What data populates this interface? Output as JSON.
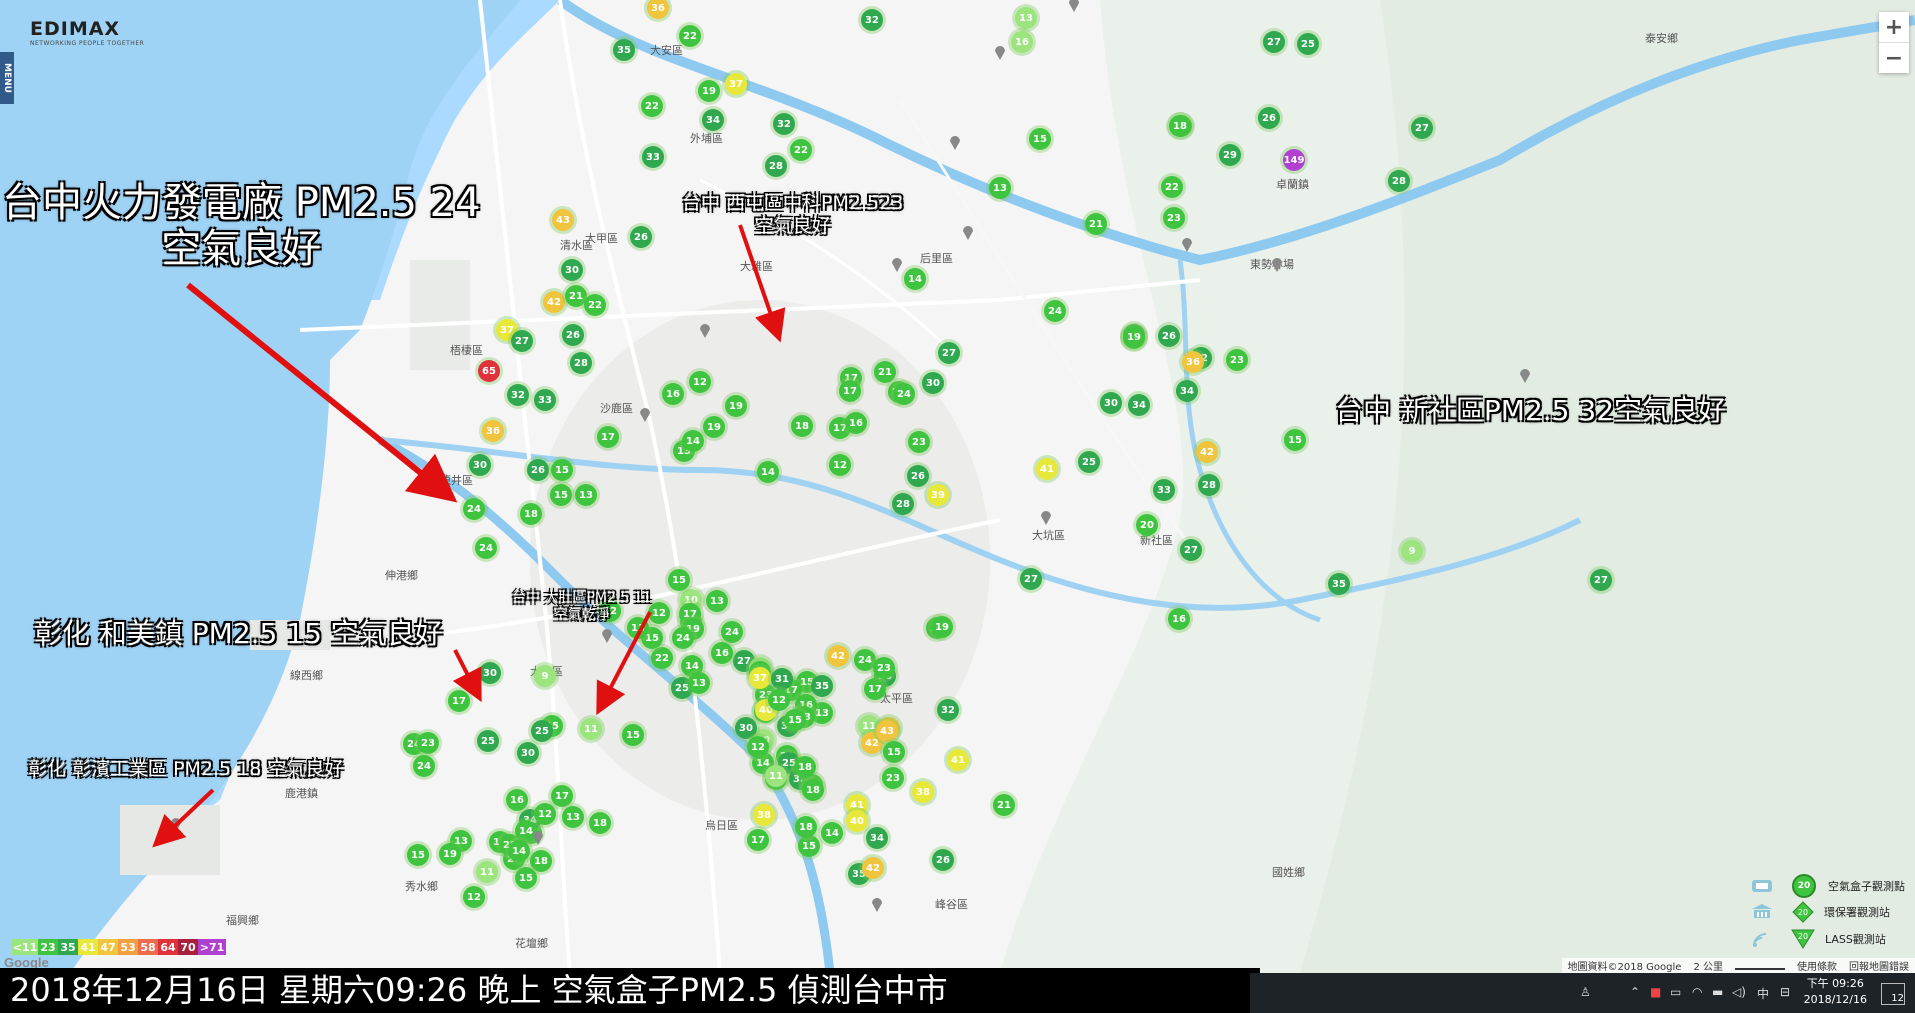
{
  "brand": {
    "name": "EDIMAX",
    "tagline": "NETWORKING PEOPLE TOGETHER"
  },
  "menu_label": "MENU",
  "zoom": {
    "in": "+",
    "out": "−"
  },
  "annotations": [
    {
      "id": "taichung-power",
      "lines": [
        "台中火力發電廠 PM2.5 24",
        "空氣良好"
      ]
    },
    {
      "id": "xitun",
      "lines": [
        "台中 西屯區中科PM2.523",
        "空氣良好"
      ]
    },
    {
      "id": "xinshe",
      "lines": [
        "台中 新社區PM2.5  32空氣良好"
      ]
    },
    {
      "id": "dadu",
      "lines": [
        "台中 大肚區PM2.5 11",
        "空氣乾淨"
      ]
    },
    {
      "id": "hemei",
      "lines": [
        "彰化 和美鎮 PM2.5 15 空氣良好"
      ]
    },
    {
      "id": "changbin",
      "lines": [
        "彰化 彰濱工業區 PM2.5  18 空氣良好"
      ]
    }
  ],
  "place_names": [
    "大安區",
    "大甲區",
    "大雅區",
    "沙鹿區",
    "梧棲區",
    "龍井區",
    "伸港鄉",
    "線西鄉",
    "大肚區",
    "鹿港鎮",
    "秀水鄉",
    "花壇鄉",
    "福興鄉",
    "峰谷區",
    "國姓鄉",
    "泰安鄉",
    "卓蘭鎮",
    "大坑區",
    "烏日區",
    "新社區",
    "東勢林場",
    "太平區",
    "后里區",
    "外埔區",
    "清水區"
  ],
  "legend": [
    {
      "label": "空氣盒子觀測點",
      "icon": "airbox-station-icon"
    },
    {
      "label": "環保署觀測站",
      "icon": "epa-station-icon"
    },
    {
      "label": "LASS觀測站",
      "icon": "lass-station-icon"
    }
  ],
  "legend_sample_value": "20",
  "pm_scale": [
    {
      "label": "<11",
      "color": "#9be47e"
    },
    {
      "label": "23",
      "color": "#3fc43f"
    },
    {
      "label": "35",
      "color": "#2fa84f"
    },
    {
      "label": "41",
      "color": "#e8e83a"
    },
    {
      "label": "47",
      "color": "#f0c43c"
    },
    {
      "label": "53",
      "color": "#f0a040"
    },
    {
      "label": "58",
      "color": "#ec6c4c"
    },
    {
      "label": "64",
      "color": "#e0323a"
    },
    {
      "label": "70",
      "color": "#a8203c"
    },
    {
      "label": ">71",
      "color": "#b040d0"
    }
  ],
  "attribution": {
    "data": "地圖資料©2018 Google",
    "scale": "2 公里",
    "terms": "使用條款",
    "report": "回報地圖錯誤"
  },
  "google_logo": "Google",
  "caption": "2018年12月16日 星期六09:26 晚上 空氣盒子PM2.5 偵測台中市",
  "clock": {
    "time": "下午 09:26",
    "date": "2018/12/16"
  },
  "notifications": "12",
  "tray_ime": "中",
  "markers": [
    [
      "36",
      "#f0c43c"
    ],
    [
      "32",
      "#2fa84f"
    ],
    [
      "13",
      "#9be47e"
    ],
    [
      "16",
      "#9be47e"
    ],
    [
      "22",
      "#3fc43f"
    ],
    [
      "27",
      "#2fa84f"
    ],
    [
      "25",
      "#2fa84f"
    ],
    [
      "35",
      "#2fa84f"
    ],
    [
      "19",
      "#3fc43f"
    ],
    [
      "37",
      "#e8e83a"
    ],
    [
      "34",
      "#2fa84f"
    ],
    [
      "22",
      "#3fc43f"
    ],
    [
      "32",
      "#2fa84f"
    ],
    [
      "33",
      "#2fa84f"
    ],
    [
      "28",
      "#2fa84f"
    ],
    [
      "22",
      "#3fc43f"
    ],
    [
      "18",
      "#3fc43f"
    ],
    [
      "15",
      "#3fc43f"
    ],
    [
      "18",
      "#3fc43f"
    ],
    [
      "26",
      "#2fa84f"
    ],
    [
      "29",
      "#2fa84f"
    ],
    [
      "149",
      "#b040d0"
    ],
    [
      "13",
      "#3fc43f"
    ],
    [
      "22",
      "#3fc43f"
    ],
    [
      "21",
      "#3fc43f"
    ],
    [
      "23",
      "#3fc43f"
    ],
    [
      "28",
      "#2fa84f"
    ],
    [
      "27",
      "#2fa84f"
    ],
    [
      "43",
      "#f0c43c"
    ],
    [
      "26",
      "#2fa84f"
    ],
    [
      "30",
      "#2fa84f"
    ],
    [
      "14",
      "#3fc43f"
    ],
    [
      "42",
      "#f0c43c"
    ],
    [
      "21",
      "#3fc43f"
    ],
    [
      "22",
      "#3fc43f"
    ],
    [
      "37",
      "#e8e83a"
    ],
    [
      "27",
      "#2fa84f"
    ],
    [
      "26",
      "#2fa84f"
    ],
    [
      "28",
      "#2fa84f"
    ],
    [
      "65",
      "#e0323a"
    ],
    [
      "32",
      "#2fa84f"
    ],
    [
      "33",
      "#2fa84f"
    ],
    [
      "16",
      "#3fc43f"
    ],
    [
      "19",
      "#3fc43f"
    ],
    [
      "29",
      "#2fa84f"
    ],
    [
      "36",
      "#f0c43c"
    ],
    [
      "30",
      "#2fa84f"
    ],
    [
      "26",
      "#2fa84f"
    ],
    [
      "15",
      "#3fc43f"
    ],
    [
      "24",
      "#3fc43f"
    ],
    [
      "24",
      "#3fc43f"
    ],
    [
      "18",
      "#3fc43f"
    ],
    [
      "15",
      "#3fc43f"
    ],
    [
      "13",
      "#3fc43f"
    ],
    [
      "17",
      "#3fc43f"
    ],
    [
      "19",
      "#3fc43f"
    ],
    [
      "17",
      "#3fc43f"
    ],
    [
      "16",
      "#3fc43f"
    ],
    [
      "18",
      "#3fc43f"
    ],
    [
      "14",
      "#3fc43f"
    ],
    [
      "12",
      "#3fc43f"
    ],
    [
      "13",
      "#3fc43f"
    ],
    [
      "14",
      "#3fc43f"
    ],
    [
      "17",
      "#3fc43f"
    ],
    [
      "21",
      "#3fc43f"
    ],
    [
      "27",
      "#2fa84f"
    ],
    [
      "30",
      "#2fa84f"
    ],
    [
      "21",
      "#3fc43f"
    ],
    [
      "24",
      "#3fc43f"
    ],
    [
      "23",
      "#3fc43f"
    ],
    [
      "26",
      "#2fa84f"
    ],
    [
      "12",
      "#3fc43f"
    ],
    [
      "17",
      "#3fc43f"
    ],
    [
      "39",
      "#e8e83a"
    ],
    [
      "28",
      "#2fa84f"
    ],
    [
      "19",
      "#3fc43f"
    ],
    [
      "30",
      "#2fa84f"
    ],
    [
      "34",
      "#2fa84f"
    ],
    [
      "41",
      "#e8e83a"
    ],
    [
      "25",
      "#2fa84f"
    ],
    [
      "33",
      "#2fa84f"
    ],
    [
      "42",
      "#f0c43c"
    ],
    [
      "28",
      "#2fa84f"
    ],
    [
      "20",
      "#3fc43f"
    ],
    [
      "27",
      "#2fa84f"
    ],
    [
      "34",
      "#2fa84f"
    ],
    [
      "32",
      "#2fa84f"
    ],
    [
      "24",
      "#3fc43f"
    ],
    [
      "19",
      "#3fc43f"
    ],
    [
      "26",
      "#2fa84f"
    ],
    [
      "23",
      "#3fc43f"
    ],
    [
      "15",
      "#3fc43f"
    ],
    [
      "9",
      "#9be47e"
    ],
    [
      "27",
      "#2fa84f"
    ],
    [
      "35",
      "#2fa84f"
    ],
    [
      "16",
      "#3fc43f"
    ],
    [
      "36",
      "#f0c43c"
    ],
    [
      "27",
      "#2fa84f"
    ],
    [
      "10",
      "#9be47e"
    ],
    [
      "15",
      "#3fc43f"
    ],
    [
      "14",
      "#3fc43f"
    ],
    [
      "17",
      "#3fc43f"
    ],
    [
      "22",
      "#3fc43f"
    ],
    [
      "12",
      "#3fc43f"
    ],
    [
      "27",
      "#2fa84f"
    ],
    [
      "15",
      "#3fc43f"
    ],
    [
      "13",
      "#3fc43f"
    ],
    [
      "12",
      "#3fc43f"
    ],
    [
      "19",
      "#3fc43f"
    ],
    [
      "24",
      "#3fc43f"
    ],
    [
      "13",
      "#3fc43f"
    ],
    [
      "14",
      "#3fc43f"
    ],
    [
      "24",
      "#3fc43f"
    ],
    [
      "25",
      "#2fa84f"
    ],
    [
      "16",
      "#3fc43f"
    ],
    [
      "23",
      "#3fc43f"
    ],
    [
      "13",
      "#3fc43f"
    ],
    [
      "9",
      "#9be47e"
    ],
    [
      "11",
      "#9be47e"
    ],
    [
      "15",
      "#3fc43f"
    ],
    [
      "14",
      "#3fc43f"
    ],
    [
      "10",
      "#9be47e"
    ],
    [
      "42",
      "#f0c43c"
    ],
    [
      "24",
      "#3fc43f"
    ],
    [
      "28",
      "#2fa84f"
    ],
    [
      "17",
      "#3fc43f"
    ],
    [
      "23",
      "#3fc43f"
    ],
    [
      "11",
      "#9be47e"
    ],
    [
      "15",
      "#3fc43f"
    ],
    [
      "13",
      "#3fc43f"
    ],
    [
      "17",
      "#3fc43f"
    ],
    [
      "14",
      "#3fc43f"
    ],
    [
      "10",
      "#9be47e"
    ],
    [
      "21",
      "#3fc43f"
    ],
    [
      "23",
      "#3fc43f"
    ],
    [
      "22",
      "#3fc43f"
    ],
    [
      "25",
      "#2fa84f"
    ],
    [
      "35",
      "#2fa84f"
    ],
    [
      "36",
      "#f0c43c"
    ],
    [
      "32",
      "#2fa84f"
    ],
    [
      "41",
      "#e8e83a"
    ],
    [
      "38",
      "#e8e83a"
    ],
    [
      "42",
      "#f0c43c"
    ],
    [
      "43",
      "#f0c43c"
    ],
    [
      "17",
      "#3fc43f"
    ],
    [
      "19",
      "#3fc43f"
    ],
    [
      "15",
      "#3fc43f"
    ],
    [
      "23",
      "#3fc43f"
    ],
    [
      "41",
      "#e8e83a"
    ],
    [
      "34",
      "#2fa84f"
    ],
    [
      "40",
      "#e8e83a"
    ],
    [
      "35",
      "#2fa84f"
    ],
    [
      "42",
      "#f0c43c"
    ],
    [
      "38",
      "#e8e83a"
    ],
    [
      "32",
      "#2fa84f"
    ],
    [
      "31",
      "#2fa84f"
    ],
    [
      "37",
      "#e8e83a"
    ],
    [
      "31",
      "#2fa84f"
    ],
    [
      "40",
      "#e8e83a"
    ],
    [
      "12",
      "#3fc43f"
    ],
    [
      "16",
      "#3fc43f"
    ],
    [
      "13",
      "#3fc43f"
    ],
    [
      "14",
      "#3fc43f"
    ],
    [
      "15",
      "#3fc43f"
    ],
    [
      "18",
      "#3fc43f"
    ],
    [
      "26",
      "#2fa84f"
    ],
    [
      "21",
      "#3fc43f"
    ],
    [
      "18",
      "#3fc43f"
    ],
    [
      "17",
      "#3fc43f"
    ],
    [
      "18",
      "#3fc43f"
    ],
    [
      "13",
      "#3fc43f"
    ],
    [
      "30",
      "#2fa84f"
    ],
    [
      "12",
      "#3fc43f"
    ],
    [
      "11",
      "#9be47e"
    ],
    [
      "15",
      "#3fc43f"
    ],
    [
      "18",
      "#3fc43f"
    ],
    [
      "14",
      "#3fc43f"
    ],
    [
      "13",
      "#3fc43f"
    ],
    [
      "20",
      "#3fc43f"
    ],
    [
      "34",
      "#2fa84f"
    ],
    [
      "16",
      "#3fc43f"
    ],
    [
      "22",
      "#3fc43f"
    ],
    [
      "30",
      "#2fa84f"
    ],
    [
      "15",
      "#3fc43f"
    ],
    [
      "14",
      "#3fc43f"
    ],
    [
      "17",
      "#3fc43f"
    ],
    [
      "18",
      "#3fc43f"
    ],
    [
      "12",
      "#3fc43f"
    ],
    [
      "13",
      "#3fc43f"
    ],
    [
      "14",
      "#3fc43f"
    ],
    [
      "15",
      "#3fc43f"
    ],
    [
      "11",
      "#9be47e"
    ],
    [
      "12",
      "#3fc43f"
    ],
    [
      "13",
      "#3fc43f"
    ],
    [
      "19",
      "#3fc43f"
    ],
    [
      "15",
      "#3fc43f"
    ],
    [
      "24",
      "#3fc43f"
    ],
    [
      "23",
      "#3fc43f"
    ],
    [
      "24",
      "#3fc43f"
    ],
    [
      "25",
      "#2fa84f"
    ],
    [
      "17",
      "#3fc43f"
    ],
    [
      "30",
      "#2fa84f"
    ],
    [
      "25",
      "#2fa84f"
    ],
    [
      "27",
      "#2fa84f"
    ],
    [
      "41",
      "#e8e83a"
    ],
    [
      "24",
      "#3fc43f"
    ],
    [
      "32",
      "#2fa84f"
    ],
    [
      "20",
      "#3fc43f"
    ],
    [
      "19",
      "#3fc43f"
    ],
    [
      "30",
      "#2fa84f"
    ]
  ]
}
